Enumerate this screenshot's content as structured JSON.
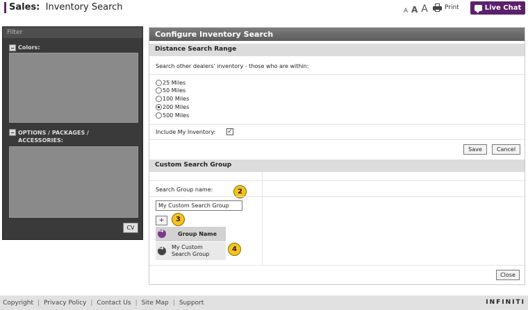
{
  "header": {
    "section": "Sales:",
    "page": "Inventory Search",
    "font_sizes": [
      "A",
      "A",
      "A"
    ],
    "print_label": "Print",
    "live_chat_label": "Live Chat"
  },
  "filter": {
    "title": "Filter",
    "colors_label": "Colors:",
    "options_label": "OPTIONS / PACKAGES / ACCESSORIES:",
    "cv_label": "CV"
  },
  "main": {
    "title": "Configure Inventory Search",
    "distance": {
      "heading": "Distance Search Range",
      "prompt": "Search other dealers' inventory - those who are within:",
      "options": [
        "25 Miles",
        "50 Miles",
        "100 Miles",
        "200 Miles",
        "500 Miles"
      ],
      "selected": "200 Miles",
      "include_label": "Include My Inventory:",
      "include_checked": true,
      "save_label": "Save",
      "cancel_label": "Cancel"
    },
    "custom_group": {
      "heading": "Custom Search Group",
      "name_label": "Search Group name:",
      "name_value": "My Custom Search Group",
      "add_label": "+",
      "column_header": "Group Name",
      "rows": [
        "My Custom Search Group"
      ],
      "callouts": [
        "2",
        "3",
        "4"
      ]
    },
    "close_label": "Close"
  },
  "footer": {
    "links": [
      "Copyright",
      "Privacy Policy",
      "Contact Us",
      "Site Map",
      "Support"
    ],
    "brand": "INFINITI"
  },
  "colors": {
    "accent": "#5b1f6b",
    "callout": "#f7c21d"
  }
}
